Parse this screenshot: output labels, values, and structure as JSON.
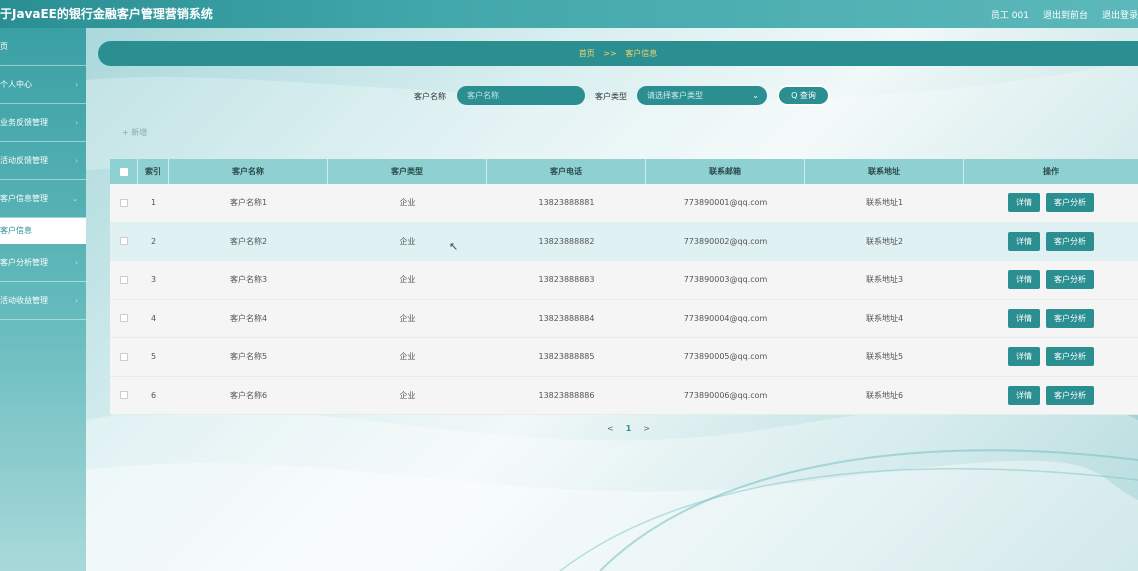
{
  "app": {
    "title": "于JavaEE的银行金融客户管理营销系统",
    "user_label": "员工 001",
    "to_frontend": "退出到前台",
    "logout": "退出登录"
  },
  "sidebar": {
    "items": [
      {
        "label": "页",
        "active": false
      },
      {
        "label": "个人中心",
        "active": false
      },
      {
        "label": "业务反馈管理",
        "active": false
      },
      {
        "label": "活动反馈管理",
        "active": false
      },
      {
        "label": "客户信息管理",
        "active": false
      },
      {
        "label": "客户信息",
        "active": true
      },
      {
        "label": "客户分析管理",
        "active": false
      },
      {
        "label": "活动收益管理",
        "active": false
      }
    ]
  },
  "breadcrumb": {
    "home": "首页",
    "separator": ">>",
    "current": "客户信息"
  },
  "search": {
    "name_label": "客户名称",
    "name_placeholder": "客户名称",
    "type_label": "客户类型",
    "type_placeholder": "请选择客户类型",
    "query_label": "Q 查询"
  },
  "add_label": "+ 新增",
  "table": {
    "headers": [
      "",
      "索引",
      "客户名称",
      "客户类型",
      "客户电话",
      "联系邮箱",
      "联系地址",
      "操作"
    ],
    "rows": [
      {
        "index": "1",
        "name": "客户名称1",
        "type": "企业",
        "phone": "13823888881",
        "email": "773890001@qq.com",
        "address": "联系地址1"
      },
      {
        "index": "2",
        "name": "客户名称2",
        "type": "企业",
        "phone": "13823888882",
        "email": "773890002@qq.com",
        "address": "联系地址2"
      },
      {
        "index": "3",
        "name": "客户名称3",
        "type": "企业",
        "phone": "13823888883",
        "email": "773890003@qq.com",
        "address": "联系地址3"
      },
      {
        "index": "4",
        "name": "客户名称4",
        "type": "企业",
        "phone": "13823888884",
        "email": "773890004@qq.com",
        "address": "联系地址4"
      },
      {
        "index": "5",
        "name": "客户名称5",
        "type": "企业",
        "phone": "13823888885",
        "email": "773890005@qq.com",
        "address": "联系地址5"
      },
      {
        "index": "6",
        "name": "客户名称6",
        "type": "企业",
        "phone": "13823888886",
        "email": "773890006@qq.com",
        "address": "联系地址6"
      }
    ],
    "detail_label": "详情",
    "analysis_label": "客户分析"
  },
  "pagination": {
    "prev": "<",
    "current": "1",
    "next": ">"
  },
  "colors": {
    "accent": "#2b8f92",
    "header_bg": "#8fd1d3",
    "breadcrumb_text": "#f5d36b"
  }
}
